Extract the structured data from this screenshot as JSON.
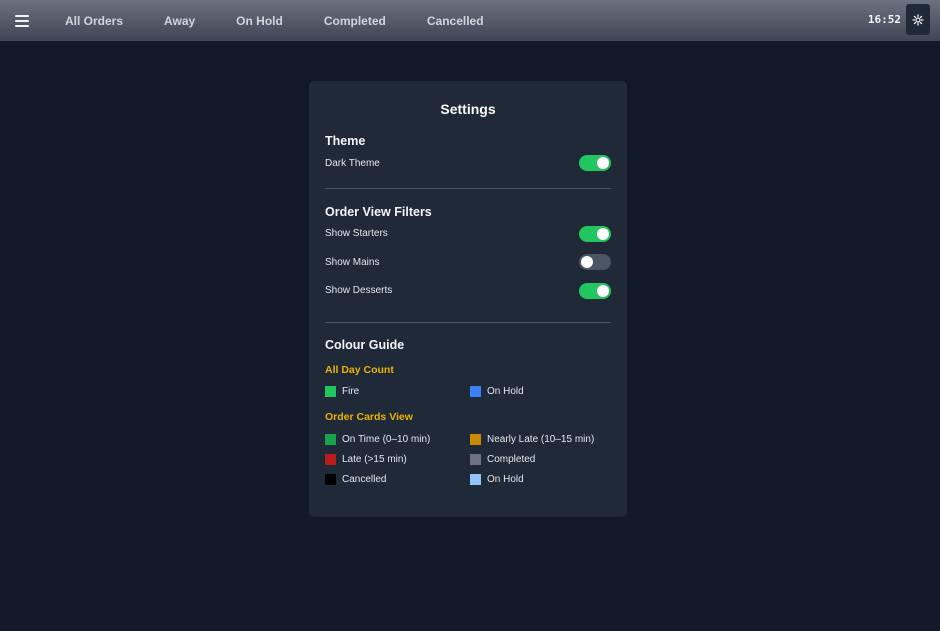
{
  "topbar": {
    "tabs": [
      "All Orders",
      "Away",
      "On Hold",
      "Completed",
      "Cancelled"
    ],
    "clock": "16:52"
  },
  "settings": {
    "title": "Settings",
    "theme": {
      "heading": "Theme",
      "dark_theme": {
        "label": "Dark Theme",
        "on": true
      }
    },
    "filters": {
      "heading": "Order View Filters",
      "items": [
        {
          "label": "Show Starters",
          "on": true
        },
        {
          "label": "Show Mains",
          "on": false
        },
        {
          "label": "Show Desserts",
          "on": true
        }
      ]
    },
    "colour_guide": {
      "heading": "Colour Guide",
      "all_day": {
        "title": "All Day Count",
        "items": [
          {
            "label": "Fire",
            "color": "#22c55e"
          },
          {
            "label": "On Hold",
            "color": "#3b82f6"
          }
        ]
      },
      "order_cards": {
        "title": "Order Cards View",
        "items": [
          {
            "label": "On Time (0–10 min)",
            "color": "#16a34a"
          },
          {
            "label": "Nearly Late (10–15 min)",
            "color": "#ca8a04"
          },
          {
            "label": "Late (>15 min)",
            "color": "#b91c1c"
          },
          {
            "label": "Completed",
            "color": "#6b7280"
          },
          {
            "label": "Cancelled",
            "color": "#000000"
          },
          {
            "label": "On Hold",
            "color": "#93c5fd"
          }
        ]
      }
    }
  },
  "colors": {
    "background": "#111827",
    "panel": "#1f2937",
    "toggle_on": "#22c55e",
    "toggle_off": "#4b5563",
    "subheading": "#eab308"
  },
  "icons": {
    "menu": "hamburger-menu-icon",
    "settings": "gear-icon"
  }
}
